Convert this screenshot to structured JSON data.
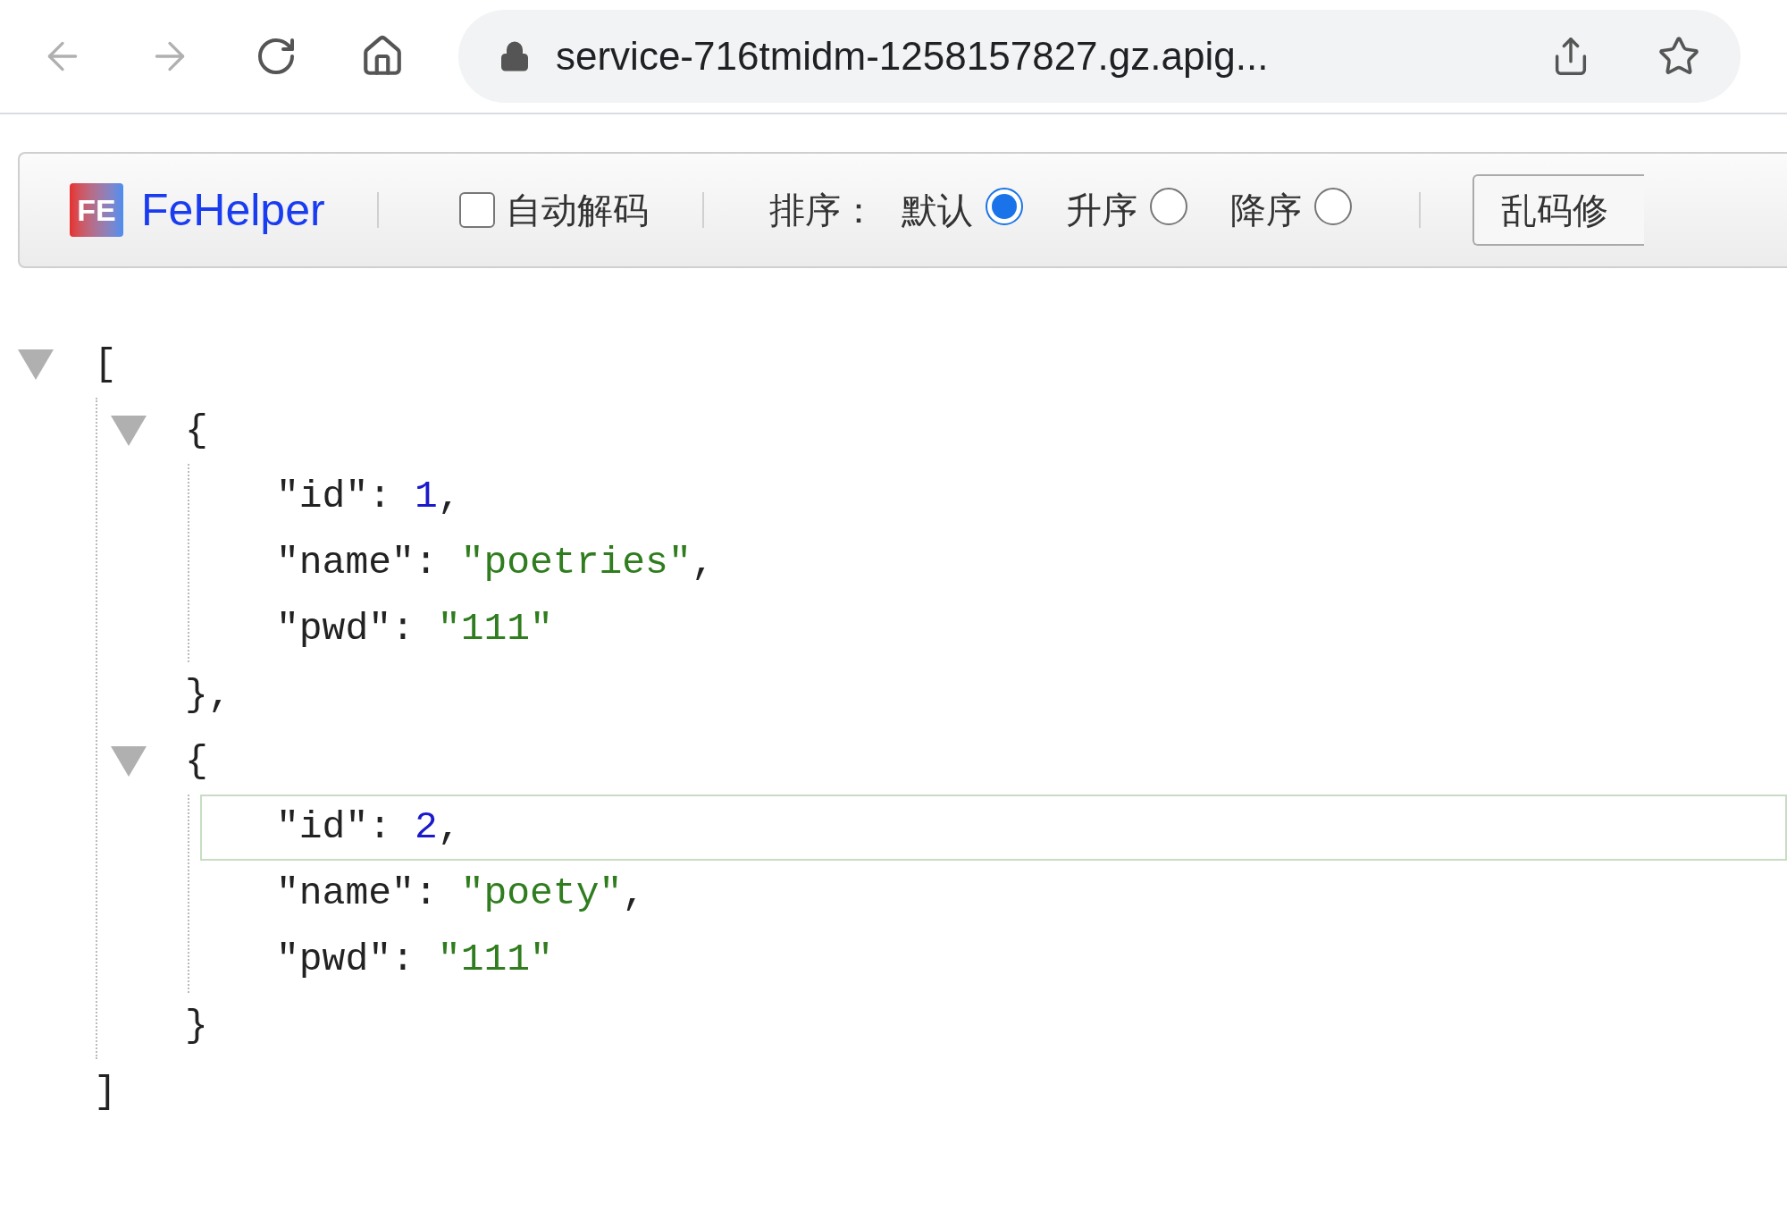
{
  "browser": {
    "url": "service-716tmidm-1258157827.gz.apig..."
  },
  "toolbar": {
    "logo_text": "FE",
    "brand": "FeHelper",
    "auto_decode": {
      "label": "自动解码",
      "checked": false
    },
    "sort_label": "排序：",
    "sort_options": [
      {
        "label": "默认",
        "selected": true
      },
      {
        "label": "升序",
        "selected": false
      },
      {
        "label": "降序",
        "selected": false
      }
    ],
    "fix_button": "乱码修"
  },
  "tree": {
    "open": "[",
    "close": "]",
    "expanded": true,
    "items": [
      {
        "open": "{",
        "close": "},",
        "expanded": true,
        "fields": [
          {
            "key": "\"id\":",
            "value": "1",
            "kind": "number",
            "trailing": ",",
            "selected": false
          },
          {
            "key": "\"name\":",
            "value": "\"poetries\"",
            "kind": "string",
            "trailing": ",",
            "selected": false
          },
          {
            "key": "\"pwd\":",
            "value": "\"111\"",
            "kind": "string",
            "selected": false
          }
        ]
      },
      {
        "open": "{",
        "close": "}",
        "expanded": true,
        "fields": [
          {
            "key": "\"id\":",
            "value": "2",
            "kind": "number",
            "trailing": ",",
            "selected": true
          },
          {
            "key": "\"name\":",
            "value": "\"poety\"",
            "kind": "string",
            "trailing": ",",
            "selected": false
          },
          {
            "key": "\"pwd\":",
            "value": "\"111\"",
            "kind": "string",
            "selected": false
          }
        ]
      }
    ]
  }
}
